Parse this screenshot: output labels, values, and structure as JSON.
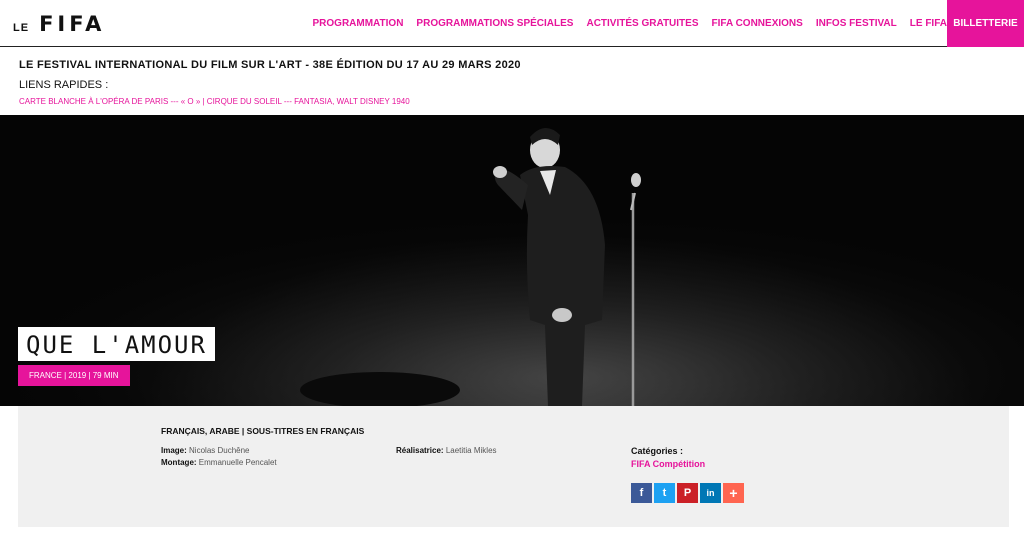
{
  "header": {
    "logo_prefix": "LE",
    "logo_main": "FIFA",
    "nav": [
      {
        "label": "PROGRAMMATION"
      },
      {
        "label": "PROGRAMMATIONS SPÉCIALES"
      },
      {
        "label": "ACTIVITÉS GRATUITES"
      },
      {
        "label": "FIFA CONNEXIONS"
      },
      {
        "label": "INFOS FESTIVAL"
      },
      {
        "label": "LE FIFA"
      }
    ],
    "ticket_label": "BILLETTERIE"
  },
  "subheader": {
    "festival_title": "LE FESTIVAL INTERNATIONAL DU FILM SUR L'ART - 38E ÉDITION DU 17 AU 29 MARS 2020",
    "quick_links_title": "LIENS RAPIDES :",
    "quick_links": [
      {
        "label": "CARTE BLANCHE À L'OPÉRA DE PARIS"
      },
      {
        "label": "« O » | CIRQUE DU SOLEIL"
      },
      {
        "label": "FANTASIA, WALT DISNEY 1940"
      }
    ],
    "separator": " --- "
  },
  "film": {
    "title": "QUE L'AMOUR",
    "meta": "FRANCE | 2019 | 79 MIN"
  },
  "details": {
    "languages": "FRANÇAIS, ARABE | SOUS-TITRES EN FRANÇAIS",
    "image_label": "Image:",
    "image_value": "Nicolas Duchêne",
    "montage_label": "Montage:",
    "montage_value": "Emmanuelle Pencalet",
    "director_label": "Réalisatrice:",
    "director_value": "Laetitia Mikles",
    "categories_title": "Catégories :",
    "category": "FIFA Compétition"
  },
  "share": [
    {
      "icon": "facebook-icon",
      "glyph": "f",
      "color": "#3b5998"
    },
    {
      "icon": "twitter-icon",
      "glyph": "t",
      "color": "#1da1f2"
    },
    {
      "icon": "pinterest-icon",
      "glyph": "P",
      "color": "#cb2027"
    },
    {
      "icon": "linkedin-icon",
      "glyph": "in",
      "color": "#0077b5"
    },
    {
      "icon": "plus-icon",
      "glyph": "+",
      "color": "#ff6550"
    }
  ],
  "colors": {
    "accent": "#e6149b"
  }
}
